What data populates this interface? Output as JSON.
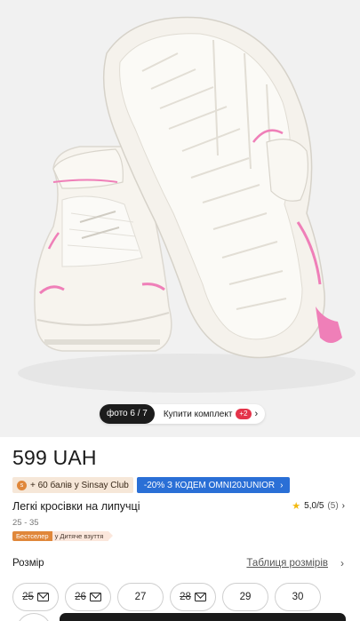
{
  "photo": {
    "counter": "фото 6 / 7",
    "set_label": "Купити комплект",
    "set_badge": "+2"
  },
  "product": {
    "price": "599 UAH",
    "club_text": "+ 60 балів у Sinsay Club",
    "promo_code_text": "-20% З КОДЕМ OMNI20JUNIOR",
    "name": "Легкі кросівки на липучці",
    "rating": "5,0/5",
    "rating_count": "(5)",
    "size_range": "25 - 35",
    "badge_bestseller": "Бестселер",
    "badge_category": "у Дитяче взуття"
  },
  "size_section": {
    "label": "Розмір",
    "table_link": "Таблиця розмірів",
    "sizes": [
      {
        "value": "25",
        "available": false
      },
      {
        "value": "26",
        "available": false
      },
      {
        "value": "27",
        "available": true
      },
      {
        "value": "28",
        "available": false
      },
      {
        "value": "29",
        "available": true
      },
      {
        "value": "30",
        "available": true
      }
    ]
  },
  "colors": {
    "accent_blue": "#2a6fd6",
    "badge_red": "#e4344a",
    "bestseller_orange": "#e0873a",
    "shoe_pink": "#ef7fb8"
  }
}
